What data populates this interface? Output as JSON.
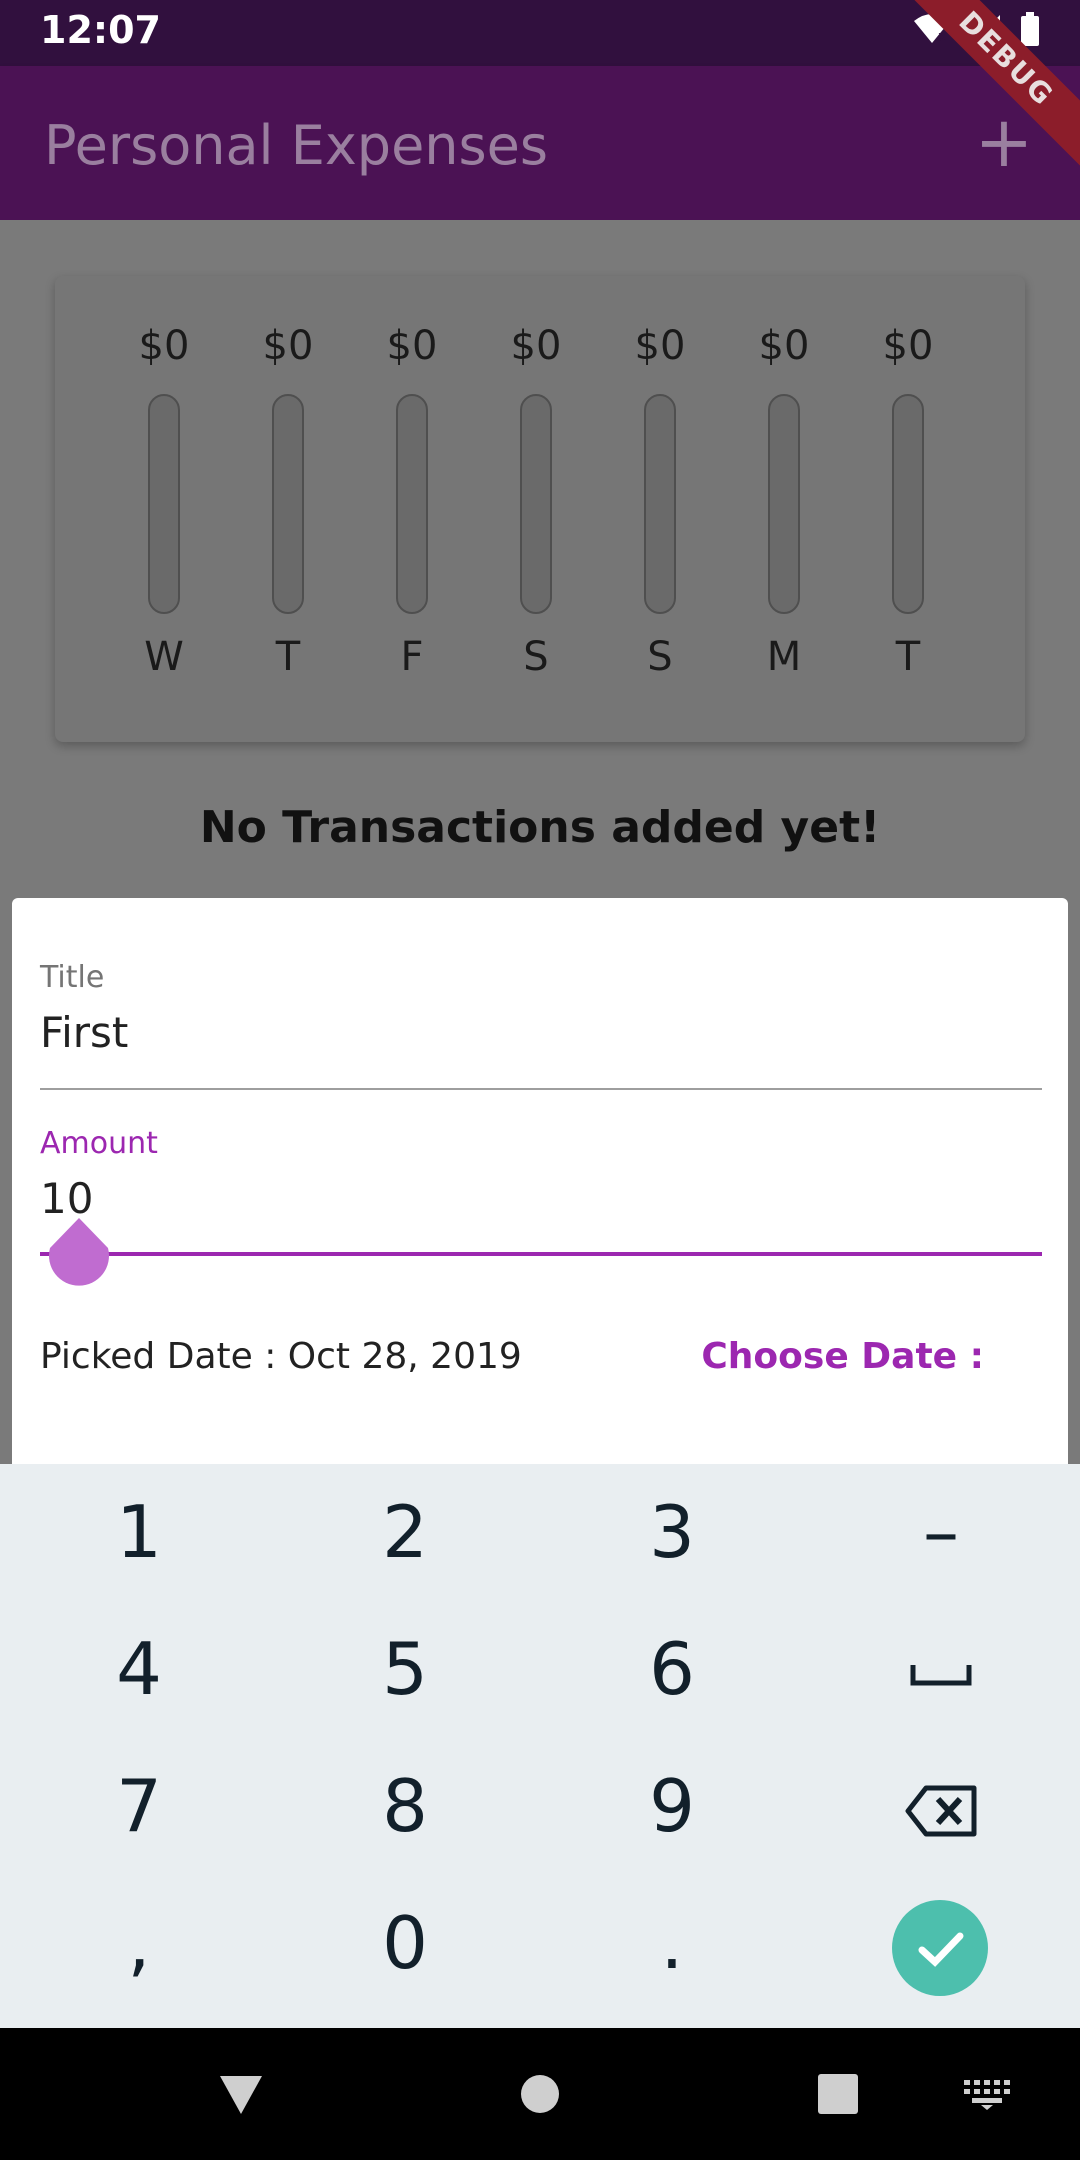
{
  "status_bar": {
    "time": "12:07"
  },
  "app_bar": {
    "title": "Personal Expenses",
    "add_label": "+",
    "debug_label": "DEBUG"
  },
  "chart": {
    "days": [
      {
        "day": "W",
        "amount": "$0",
        "fraction": 0
      },
      {
        "day": "T",
        "amount": "$0",
        "fraction": 0
      },
      {
        "day": "F",
        "amount": "$0",
        "fraction": 0
      },
      {
        "day": "S",
        "amount": "$0",
        "fraction": 0
      },
      {
        "day": "S",
        "amount": "$0",
        "fraction": 0
      },
      {
        "day": "M",
        "amount": "$0",
        "fraction": 0
      },
      {
        "day": "T",
        "amount": "$0",
        "fraction": 0
      }
    ]
  },
  "empty_message": "No Transactions added yet!",
  "form": {
    "title_label": "Title",
    "title_value": "First",
    "amount_label": "Amount",
    "amount_value": "10",
    "picked_date": "Picked Date : Oct 28, 2019",
    "choose_date_label": "Choose Date :",
    "accent_color": "#9c27b0"
  },
  "keyboard": {
    "rows": [
      [
        "1",
        "2",
        "3",
        "–"
      ],
      [
        "4",
        "5",
        "6",
        "space"
      ],
      [
        "7",
        "8",
        "9",
        "backspace"
      ],
      [
        ",",
        "0",
        ".",
        "done"
      ]
    ]
  }
}
